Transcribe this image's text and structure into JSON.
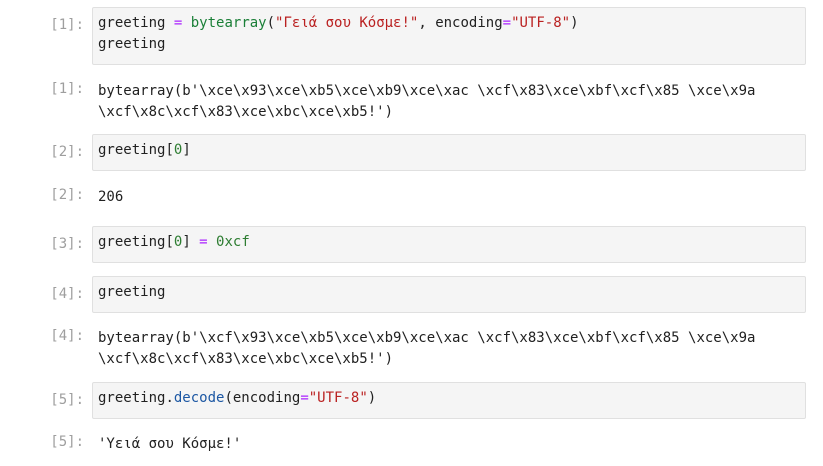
{
  "cells": [
    {
      "in_prompt": "[1]:",
      "out_prompt": "[1]:",
      "code": {
        "l1": {
          "a": "greeting",
          "b": "=",
          "c": "bytearray",
          "d": "(",
          "e": "\"Γειά σου Κόσμε!\"",
          "f": ", encoding",
          "g": "=",
          "h": "\"UTF-8\"",
          "i": ")"
        },
        "l2": "greeting"
      },
      "output": [
        "bytearray(b'\\xce\\x93\\xce\\xb5\\xce\\xb9\\xce\\xac \\xcf\\x83\\xce\\xbf\\xcf\\x85 \\xce\\x9a",
        "\\xcf\\x8c\\xcf\\x83\\xce\\xbc\\xce\\xb5!')"
      ]
    },
    {
      "in_prompt": "[2]:",
      "out_prompt": "[2]:",
      "code": {
        "a": "greeting",
        "b": "[",
        "c": "0",
        "d": "]"
      },
      "output": [
        "206"
      ]
    },
    {
      "in_prompt": "[3]:",
      "code": {
        "a": "greeting",
        "b": "[",
        "c": "0",
        "d": "] ",
        "e": "=",
        "f": " ",
        "g": "0xcf"
      }
    },
    {
      "in_prompt": "[4]:",
      "out_prompt": "[4]:",
      "code": {
        "a": "greeting"
      },
      "output": [
        "bytearray(b'\\xcf\\x93\\xce\\xb5\\xce\\xb9\\xce\\xac \\xcf\\x83\\xce\\xbf\\xcf\\x85 \\xce\\x9a",
        "\\xcf\\x8c\\xcf\\x83\\xce\\xbc\\xce\\xb5!')"
      ]
    },
    {
      "in_prompt": "[5]:",
      "out_prompt": "[5]:",
      "code": {
        "a": "greeting",
        "b": ".",
        "c": "decode",
        "d": "(encoding",
        "e": "=",
        "f": "\"UTF-8\"",
        "g": ")"
      },
      "output": [
        "'Υειά σου Κόσμε!'"
      ]
    }
  ]
}
